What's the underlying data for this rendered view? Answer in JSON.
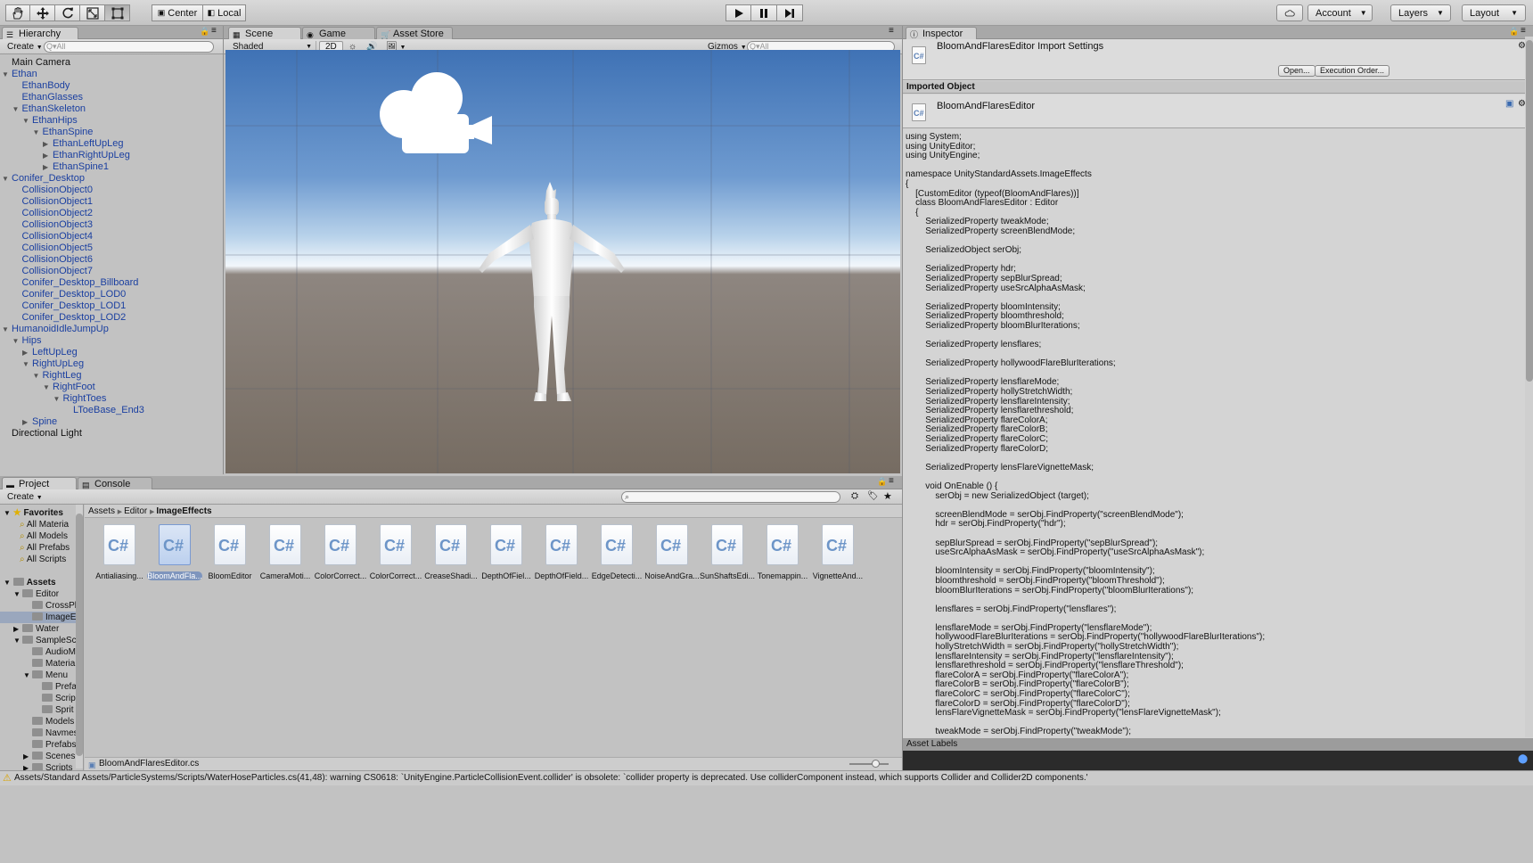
{
  "toolbar": {
    "pivot_label": "Center",
    "space_label": "Local",
    "account_label": "Account",
    "layers_label": "Layers",
    "layout_label": "Layout"
  },
  "hierarchy": {
    "tab": "Hierarchy",
    "create": "Create",
    "search_placeholder": "Q▾All",
    "items": [
      {
        "label": "Main Camera",
        "indent": 0,
        "fold": "",
        "color": "black"
      },
      {
        "label": "Ethan",
        "indent": 0,
        "fold": "▼",
        "color": "blue"
      },
      {
        "label": "EthanBody",
        "indent": 1,
        "fold": "",
        "color": "blue"
      },
      {
        "label": "EthanGlasses",
        "indent": 1,
        "fold": "",
        "color": "blue"
      },
      {
        "label": "EthanSkeleton",
        "indent": 1,
        "fold": "▼",
        "color": "blue"
      },
      {
        "label": "EthanHips",
        "indent": 2,
        "fold": "▼",
        "color": "blue"
      },
      {
        "label": "EthanSpine",
        "indent": 3,
        "fold": "▼",
        "color": "blue"
      },
      {
        "label": "EthanLeftUpLeg",
        "indent": 4,
        "fold": "▶",
        "color": "blue"
      },
      {
        "label": "EthanRightUpLeg",
        "indent": 4,
        "fold": "▶",
        "color": "blue"
      },
      {
        "label": "EthanSpine1",
        "indent": 4,
        "fold": "▶",
        "color": "blue"
      },
      {
        "label": "Conifer_Desktop",
        "indent": 0,
        "fold": "▼",
        "color": "blue"
      },
      {
        "label": "CollisionObject0",
        "indent": 1,
        "fold": "",
        "color": "blue"
      },
      {
        "label": "CollisionObject1",
        "indent": 1,
        "fold": "",
        "color": "blue"
      },
      {
        "label": "CollisionObject2",
        "indent": 1,
        "fold": "",
        "color": "blue"
      },
      {
        "label": "CollisionObject3",
        "indent": 1,
        "fold": "",
        "color": "blue"
      },
      {
        "label": "CollisionObject4",
        "indent": 1,
        "fold": "",
        "color": "blue"
      },
      {
        "label": "CollisionObject5",
        "indent": 1,
        "fold": "",
        "color": "blue"
      },
      {
        "label": "CollisionObject6",
        "indent": 1,
        "fold": "",
        "color": "blue"
      },
      {
        "label": "CollisionObject7",
        "indent": 1,
        "fold": "",
        "color": "blue"
      },
      {
        "label": "Conifer_Desktop_Billboard",
        "indent": 1,
        "fold": "",
        "color": "blue"
      },
      {
        "label": "Conifer_Desktop_LOD0",
        "indent": 1,
        "fold": "",
        "color": "blue"
      },
      {
        "label": "Conifer_Desktop_LOD1",
        "indent": 1,
        "fold": "",
        "color": "blue"
      },
      {
        "label": "Conifer_Desktop_LOD2",
        "indent": 1,
        "fold": "",
        "color": "blue"
      },
      {
        "label": "HumanoidIdleJumpUp",
        "indent": 0,
        "fold": "▼",
        "color": "blue"
      },
      {
        "label": "Hips",
        "indent": 1,
        "fold": "▼",
        "color": "blue"
      },
      {
        "label": "LeftUpLeg",
        "indent": 2,
        "fold": "▶",
        "color": "blue"
      },
      {
        "label": "RightUpLeg",
        "indent": 2,
        "fold": "▼",
        "color": "blue"
      },
      {
        "label": "RightLeg",
        "indent": 3,
        "fold": "▼",
        "color": "blue"
      },
      {
        "label": "RightFoot",
        "indent": 4,
        "fold": "▼",
        "color": "blue"
      },
      {
        "label": "RightToes",
        "indent": 5,
        "fold": "▼",
        "color": "blue"
      },
      {
        "label": "LToeBase_End3",
        "indent": 6,
        "fold": "",
        "color": "blue"
      },
      {
        "label": "Spine",
        "indent": 2,
        "fold": "▶",
        "color": "blue"
      },
      {
        "label": "Directional Light",
        "indent": 0,
        "fold": "",
        "color": "black"
      }
    ]
  },
  "scene": {
    "tabs": {
      "scene": "Scene",
      "game": "Game",
      "store": "Asset Store"
    },
    "shading": "Shaded",
    "mode2d": "2D",
    "gizmos": "Gizmos",
    "search_placeholder": "Q▾All"
  },
  "inspector": {
    "tab": "Inspector",
    "title": "BloomAndFlaresEditor Import Settings",
    "open_btn": "Open...",
    "exec_btn": "Execution Order...",
    "section": "Imported Object",
    "object_name": "BloomAndFlaresEditor",
    "asset_labels": "Asset Labels",
    "code": [
      "using System;",
      "using UnityEditor;",
      "using UnityEngine;",
      "",
      "namespace UnityStandardAssets.ImageEffects",
      "{",
      "    [CustomEditor (typeof(BloomAndFlares))]",
      "    class BloomAndFlaresEditor : Editor",
      "    {",
      "        SerializedProperty tweakMode;",
      "        SerializedProperty screenBlendMode;",
      "",
      "        SerializedObject serObj;",
      "",
      "        SerializedProperty hdr;",
      "        SerializedProperty sepBlurSpread;",
      "        SerializedProperty useSrcAlphaAsMask;",
      "",
      "        SerializedProperty bloomIntensity;",
      "        SerializedProperty bloomthreshold;",
      "        SerializedProperty bloomBlurIterations;",
      "",
      "        SerializedProperty lensflares;",
      "",
      "        SerializedProperty hollywoodFlareBlurIterations;",
      "",
      "        SerializedProperty lensflareMode;",
      "        SerializedProperty hollyStretchWidth;",
      "        SerializedProperty lensflareIntensity;",
      "        SerializedProperty lensflarethreshold;",
      "        SerializedProperty flareColorA;",
      "        SerializedProperty flareColorB;",
      "        SerializedProperty flareColorC;",
      "        SerializedProperty flareColorD;",
      "",
      "        SerializedProperty lensFlareVignetteMask;",
      "",
      "        void OnEnable () {",
      "            serObj = new SerializedObject (target);",
      "",
      "            screenBlendMode = serObj.FindProperty(\"screenBlendMode\");",
      "            hdr = serObj.FindProperty(\"hdr\");",
      "",
      "            sepBlurSpread = serObj.FindProperty(\"sepBlurSpread\");",
      "            useSrcAlphaAsMask = serObj.FindProperty(\"useSrcAlphaAsMask\");",
      "",
      "            bloomIntensity = serObj.FindProperty(\"bloomIntensity\");",
      "            bloomthreshold = serObj.FindProperty(\"bloomThreshold\");",
      "            bloomBlurIterations = serObj.FindProperty(\"bloomBlurIterations\");",
      "",
      "            lensflares = serObj.FindProperty(\"lensflares\");",
      "",
      "            lensflareMode = serObj.FindProperty(\"lensflareMode\");",
      "            hollywoodFlareBlurIterations = serObj.FindProperty(\"hollywoodFlareBlurIterations\");",
      "            hollyStretchWidth = serObj.FindProperty(\"hollyStretchWidth\");",
      "            lensflareIntensity = serObj.FindProperty(\"lensflareIntensity\");",
      "            lensflarethreshold = serObj.FindProperty(\"lensflareThreshold\");",
      "            flareColorA = serObj.FindProperty(\"flareColorA\");",
      "            flareColorB = serObj.FindProperty(\"flareColorB\");",
      "            flareColorC = serObj.FindProperty(\"flareColorC\");",
      "            flareColorD = serObj.FindProperty(\"flareColorD\");",
      "            lensFlareVignetteMask = serObj.FindProperty(\"lensFlareVignetteMask\");",
      "",
      "            tweakMode = serObj.FindProperty(\"tweakMode\");"
    ]
  },
  "project": {
    "tabs": {
      "project": "Project",
      "console": "Console"
    },
    "create": "Create",
    "breadcrumb": [
      "Assets",
      "Editor",
      "ImageEffects"
    ],
    "favorites_label": "Favorites",
    "favorites": [
      "All Materia",
      "All Models",
      "All Prefabs",
      "All Scripts"
    ],
    "assets_label": "Assets",
    "tree": [
      {
        "label": "Editor",
        "indent": 1,
        "fold": "▼",
        "sel": false
      },
      {
        "label": "CrossPl",
        "indent": 2,
        "fold": "",
        "sel": false
      },
      {
        "label": "ImageEf",
        "indent": 2,
        "fold": "",
        "sel": true
      },
      {
        "label": "Water",
        "indent": 1,
        "fold": "▶",
        "sel": false
      },
      {
        "label": "SampleSce",
        "indent": 1,
        "fold": "▼",
        "sel": false
      },
      {
        "label": "AudioM",
        "indent": 2,
        "fold": "",
        "sel": false
      },
      {
        "label": "Materia",
        "indent": 2,
        "fold": "",
        "sel": false
      },
      {
        "label": "Menu",
        "indent": 2,
        "fold": "▼",
        "sel": false
      },
      {
        "label": "Prefa",
        "indent": 3,
        "fold": "",
        "sel": false
      },
      {
        "label": "Scrip",
        "indent": 3,
        "fold": "",
        "sel": false
      },
      {
        "label": "Sprit",
        "indent": 3,
        "fold": "",
        "sel": false
      },
      {
        "label": "Models",
        "indent": 2,
        "fold": "",
        "sel": false
      },
      {
        "label": "Navmes",
        "indent": 2,
        "fold": "",
        "sel": false
      },
      {
        "label": "Prefabs",
        "indent": 2,
        "fold": "",
        "sel": false
      },
      {
        "label": "Scenes",
        "indent": 2,
        "fold": "▶",
        "sel": false
      },
      {
        "label": "Scripts",
        "indent": 2,
        "fold": "▶",
        "sel": false
      }
    ],
    "assets": [
      {
        "label": "Antialiasing...",
        "sel": false
      },
      {
        "label": "BloomAndFla...",
        "sel": true
      },
      {
        "label": "BloomEditor",
        "sel": false
      },
      {
        "label": "CameraMoti...",
        "sel": false
      },
      {
        "label": "ColorCorrect...",
        "sel": false
      },
      {
        "label": "ColorCorrect...",
        "sel": false
      },
      {
        "label": "CreaseShadi...",
        "sel": false
      },
      {
        "label": "DepthOfFiel...",
        "sel": false
      },
      {
        "label": "DepthOfField...",
        "sel": false
      },
      {
        "label": "EdgeDetecti...",
        "sel": false
      },
      {
        "label": "NoiseAndGra...",
        "sel": false
      },
      {
        "label": "SunShaftsEdi...",
        "sel": false
      },
      {
        "label": "Tonemappin...",
        "sel": false
      },
      {
        "label": "VignetteAnd...",
        "sel": false
      }
    ],
    "asset_glyph": "C#",
    "selected_file": "BloomAndFlaresEditor.cs"
  },
  "status": "Assets/Standard Assets/ParticleSystems/Scripts/WaterHoseParticles.cs(41,48): warning CS0618: `UnityEngine.ParticleCollisionEvent.collider' is obsolete: `collider property is deprecated. Use colliderComponent instead, which supports Collider and Collider2D components.'"
}
